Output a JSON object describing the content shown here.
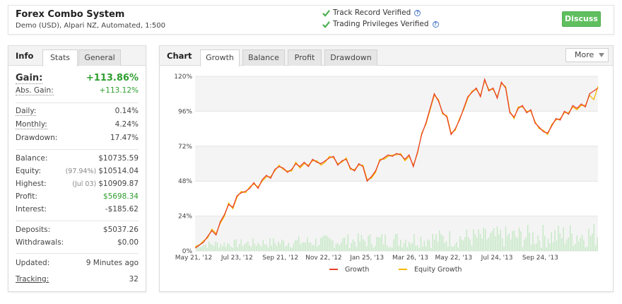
{
  "header": {
    "system_name": "Forex Combo System",
    "subtitle": "Demo (USD), Alpari NZ, Automated, 1:500",
    "verif_1": "Track Record Verified",
    "verif_2": "Trading Privileges Verified",
    "discuss_label": "Discuss",
    "check_color": "#4caf50"
  },
  "info_panel": {
    "title": "Info",
    "tabs": [
      "Stats",
      "General"
    ],
    "active_tab": "Stats",
    "rows": {
      "gain": {
        "label": "Gain:",
        "value": "+113.86%"
      },
      "abs_gain": {
        "label": "Abs. Gain:",
        "value": "+113.12%"
      },
      "daily": {
        "label": "Daily:",
        "value": "0.14%"
      },
      "monthly": {
        "label": "Monthly:",
        "value": "4.24%"
      },
      "drawdown": {
        "label": "Drawdown:",
        "value": "17.47%"
      },
      "balance": {
        "label": "Balance:",
        "value": "$10735.59"
      },
      "equity": {
        "label": "Equity:",
        "note": "(97.94%)",
        "value": "$10514.04"
      },
      "highest": {
        "label": "Highest:",
        "note": "(Jul 03)",
        "value": "$10909.87"
      },
      "profit": {
        "label": "Profit:",
        "value": "$5698.34"
      },
      "interest": {
        "label": "Interest:",
        "value": "-$185.62"
      },
      "deposits": {
        "label": "Deposits:",
        "value": "$5037.26"
      },
      "withdrawals": {
        "label": "Withdrawals:",
        "value": "$0.00"
      },
      "updated": {
        "label": "Updated:",
        "value": "9 Minutes ago"
      },
      "tracking": {
        "label": "Tracking:",
        "value": "32"
      }
    }
  },
  "chart_panel": {
    "title": "Chart",
    "tabs": [
      "Growth",
      "Balance",
      "Profit",
      "Drawdown"
    ],
    "active_tab": "Growth",
    "more_label": "More"
  },
  "chart_data": {
    "type": "line",
    "x_tick_labels": [
      "May 21, '12",
      "Jul 23, '12",
      "Sep 21, '12",
      "Nov 22, '12",
      "Jan 25, '13",
      "Mar 26, '13",
      "May 22, '13",
      "Jul 24, '13",
      "Sep 24, '13"
    ],
    "y_tick_labels": [
      "0%",
      "24%",
      "48%",
      "72%",
      "96%",
      "120%"
    ],
    "ylim": [
      0,
      120
    ],
    "series": [
      {
        "name": "Growth",
        "color": "#e8402a",
        "x": [
          0,
          5,
          10,
          15,
          20,
          25,
          30,
          35,
          40,
          45,
          50,
          55,
          60,
          65,
          70,
          75,
          80,
          85,
          90,
          95,
          100,
          105,
          110,
          115,
          120,
          125,
          130,
          135,
          140,
          145,
          150,
          155,
          160,
          165,
          170,
          175,
          180,
          185,
          190,
          195,
          200,
          205,
          210,
          215,
          220,
          225,
          230,
          235,
          240,
          245,
          250,
          255,
          260,
          265,
          270,
          275,
          280,
          285,
          290,
          295,
          300,
          305,
          310,
          315,
          320,
          325,
          330,
          335,
          340,
          345,
          350,
          355,
          360,
          365,
          370,
          375,
          380,
          385,
          390,
          395,
          400,
          405,
          410,
          415,
          420,
          425,
          430,
          435,
          440,
          445,
          450,
          455,
          460,
          465,
          470,
          475,
          480
        ],
        "values": [
          2,
          4,
          6,
          10,
          14,
          11,
          20,
          25,
          32,
          30,
          38,
          40,
          41,
          43,
          47,
          43,
          49,
          52,
          50,
          56,
          58,
          57,
          54,
          56,
          60,
          58,
          61,
          58,
          63,
          61,
          60,
          62,
          64,
          65,
          59,
          62,
          63,
          57,
          55,
          60,
          58,
          48,
          51,
          55,
          62,
          64,
          66,
          65,
          67,
          66,
          63,
          66,
          58,
          68,
          80,
          88,
          98,
          108,
          103,
          95,
          92,
          80,
          84,
          90,
          98,
          106,
          109,
          112,
          106,
          118,
          110,
          112,
          105,
          116,
          112,
          95,
          92,
          98,
          100,
          95,
          97,
          88,
          85,
          82,
          81,
          86,
          91,
          90,
          96,
          94,
          100,
          98,
          101,
          99,
          108,
          110,
          112
        ]
      },
      {
        "name": "Equity Growth",
        "color": "#f5b800",
        "x": [
          0,
          5,
          10,
          15,
          20,
          25,
          30,
          35,
          40,
          45,
          50,
          55,
          60,
          65,
          70,
          75,
          80,
          85,
          90,
          95,
          100,
          105,
          110,
          115,
          120,
          125,
          130,
          135,
          140,
          145,
          150,
          155,
          160,
          165,
          170,
          175,
          180,
          185,
          190,
          195,
          200,
          205,
          210,
          215,
          220,
          225,
          230,
          235,
          240,
          245,
          250,
          255,
          260,
          265,
          270,
          275,
          280,
          285,
          290,
          295,
          300,
          305,
          310,
          315,
          320,
          325,
          330,
          335,
          340,
          345,
          350,
          355,
          360,
          365,
          370,
          375,
          380,
          385,
          390,
          395,
          400,
          405,
          410,
          415,
          420,
          425,
          430,
          435,
          440,
          445,
          450,
          455,
          460,
          465,
          470,
          475,
          480
        ],
        "values": [
          3,
          4,
          7,
          9,
          15,
          12,
          19,
          24,
          33,
          29,
          37,
          41,
          40,
          44,
          46,
          44,
          48,
          51,
          51,
          55,
          59,
          56,
          55,
          55,
          61,
          57,
          60,
          59,
          62,
          62,
          59,
          61,
          65,
          64,
          60,
          61,
          64,
          56,
          56,
          59,
          59,
          49,
          50,
          54,
          63,
          63,
          65,
          66,
          66,
          67,
          62,
          65,
          59,
          67,
          81,
          87,
          97,
          107,
          104,
          94,
          93,
          81,
          83,
          91,
          97,
          105,
          110,
          111,
          107,
          117,
          111,
          111,
          106,
          115,
          113,
          96,
          91,
          99,
          99,
          96,
          96,
          89,
          84,
          83,
          80,
          87,
          90,
          91,
          95,
          95,
          99,
          97,
          100,
          100,
          107,
          104,
          113
        ]
      }
    ],
    "legend": [
      "Growth",
      "Equity Growth"
    ],
    "legend_position": "bottom",
    "grid": true
  }
}
